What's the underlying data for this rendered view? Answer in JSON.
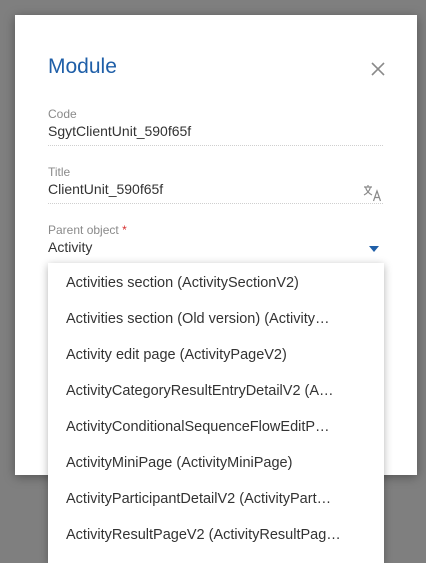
{
  "modal": {
    "title": "Module",
    "close_icon": "close-icon"
  },
  "fields": {
    "code": {
      "label": "Code",
      "value": "SgytClientUnit_590f65f"
    },
    "title": {
      "label": "Title",
      "value": "ClientUnit_590f65f",
      "icon": "translate-icon"
    },
    "parent": {
      "label": "Parent object",
      "required_mark": "*",
      "value": "Activity",
      "icon": "chevron-down-icon"
    }
  },
  "dropdown": {
    "options": [
      "Activities section (ActivitySectionV2)",
      "Activities section (Old version) (Activity…",
      "Activity edit page (ActivityPageV2)",
      "ActivityCategoryResultEntryDetailV2 (A…",
      "ActivityConditionalSequenceFlowEditP…",
      "ActivityMiniPage (ActivityMiniPage)",
      "ActivityParticipantDetailV2 (ActivityPart…",
      "ActivityResultPageV2 (ActivityResultPag…"
    ]
  },
  "colors": {
    "backdrop": "#7f7f7f",
    "accent": "#1f5fa8",
    "required": "#d62e2e"
  }
}
